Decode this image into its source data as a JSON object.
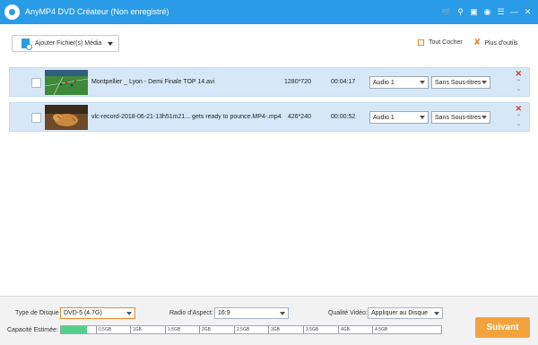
{
  "window": {
    "title": "AnyMP4 DVD Créateur (Non enregistré)",
    "icons": [
      "cart-icon",
      "key-icon",
      "register-icon",
      "help-icon",
      "menu-icon",
      "minimize-icon",
      "close-icon"
    ],
    "accent": "#2a9be6"
  },
  "toolbar": {
    "add_files_label": "Ajouter Fichier(s) Média",
    "check_all_label": "Tout Cocher",
    "more_tools_label": "Plus d'outils"
  },
  "files": [
    {
      "name": "Montpellier _ Lyon - Demi Finale TOP 14.avi",
      "resolution": "1280*720",
      "duration": "00:04:17",
      "audio": "Audio 1",
      "subtitle": "Sans Sous-titres"
    },
    {
      "name": "vlc-record-2018-06-21-13h51m21... gets ready to pounce.MP4-.mp4",
      "resolution": "426*240",
      "duration": "00:00:52",
      "audio": "Audio 1",
      "subtitle": "Sans Sous-titres"
    }
  ],
  "settings": {
    "disk_type_label": "Type de Disque",
    "disk_type_value": "DVD-5 (4.7G)",
    "aspect_label": "Radio d'Aspect:",
    "aspect_value": "16:9",
    "quality_label": "Qualité Vidéo:",
    "quality_value": "Appliquer au Disque",
    "capacity_label": "Capacité Estimée:",
    "capacity_fraction": 0.069,
    "capacity_ticks": [
      "0.5GB",
      "1GB",
      "1.5GB",
      "2GB",
      "2.5GB",
      "3GB",
      "3.5GB",
      "4GB",
      "4.5GB"
    ]
  },
  "next_button_label": "Suivant",
  "colors": {
    "row_bg": "#d6e8f8",
    "next_button": "#f3a33d",
    "capacity_fill": "#52d08a",
    "delete": "#e0302a"
  }
}
